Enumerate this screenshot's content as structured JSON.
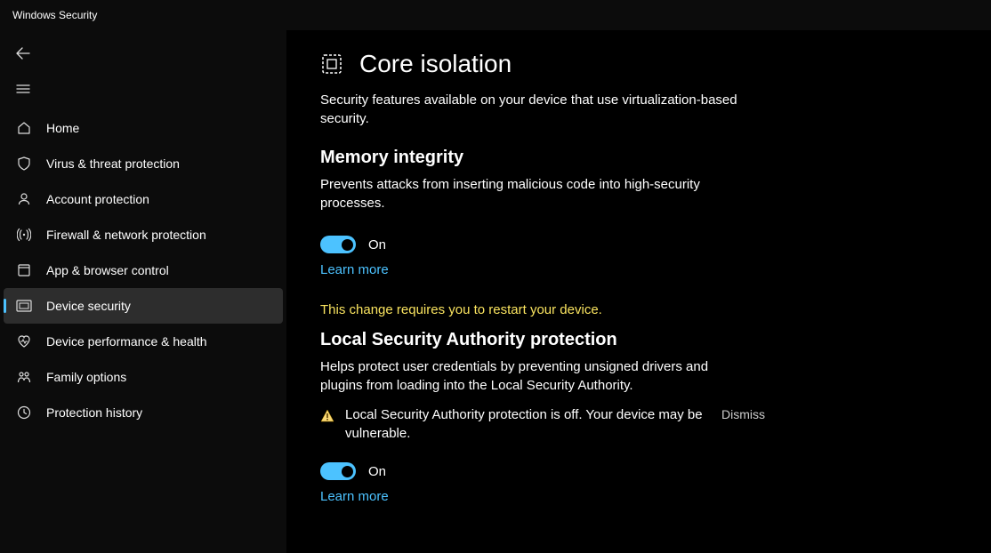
{
  "window": {
    "title": "Windows Security"
  },
  "nav": {
    "items": [
      {
        "id": "home",
        "label": "Home"
      },
      {
        "id": "virus",
        "label": "Virus & threat protection"
      },
      {
        "id": "account",
        "label": "Account protection"
      },
      {
        "id": "firewall",
        "label": "Firewall & network protection"
      },
      {
        "id": "app",
        "label": "App & browser control"
      },
      {
        "id": "device",
        "label": "Device security"
      },
      {
        "id": "perf",
        "label": "Device performance & health"
      },
      {
        "id": "family",
        "label": "Family options"
      },
      {
        "id": "history",
        "label": "Protection history"
      }
    ],
    "selected": "device"
  },
  "page": {
    "title": "Core isolation",
    "description": "Security features available on your device that use virtualization-based security."
  },
  "memory_integrity": {
    "heading": "Memory integrity",
    "description": "Prevents attacks from inserting malicious code into high-security processes.",
    "toggle_state": "On",
    "learn_more": "Learn more",
    "restart_notice": "This change requires you to restart your device."
  },
  "lsa": {
    "heading": "Local Security Authority protection",
    "description": "Helps protect user credentials by preventing unsigned drivers and plugins from loading into the Local Security Authority.",
    "warning": "Local Security Authority protection is off. Your device may be vulnerable.",
    "dismiss": "Dismiss",
    "toggle_state": "On",
    "learn_more": "Learn more"
  }
}
